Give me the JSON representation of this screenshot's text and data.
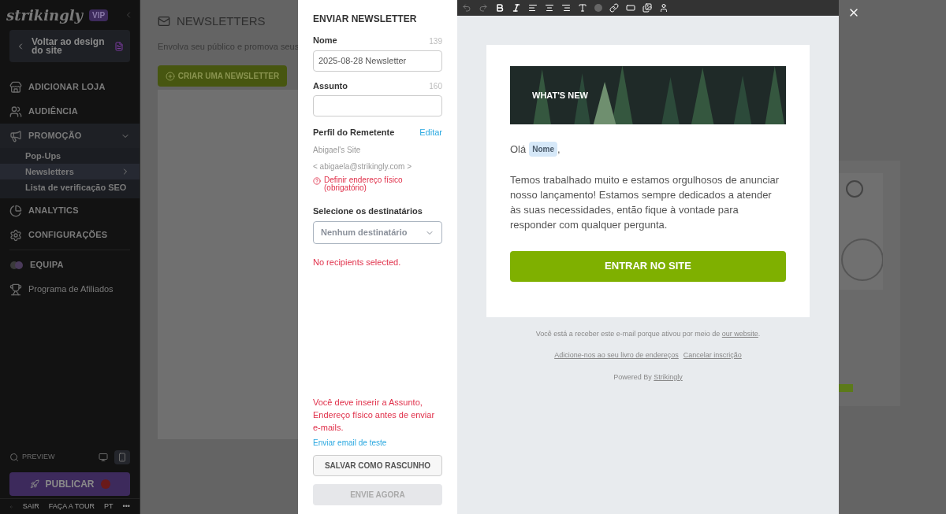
{
  "sidebar": {
    "logo": "strikingly",
    "badge": "VIP",
    "back_button": "Voltar ao design do site",
    "items": [
      {
        "label": "ADICIONAR LOJA",
        "kind": "section"
      },
      {
        "label": "AUDIÊNCIA",
        "kind": "section"
      },
      {
        "label": "PROMOÇÃO",
        "kind": "section",
        "expanded": true,
        "children": [
          {
            "label": "Pop-Ups",
            "selected": false
          },
          {
            "label": "Newsletters",
            "selected": true
          },
          {
            "label": "Lista de verificação SEO",
            "selected": false
          }
        ]
      },
      {
        "label": "ANALYTICS",
        "kind": "section"
      },
      {
        "label": "CONFIGURAÇÕES",
        "kind": "section"
      },
      {
        "label": "EQUIPA",
        "kind": "section"
      },
      {
        "label": "Programa de Afiliados",
        "kind": "plain"
      }
    ],
    "preview": "PREVIEW",
    "devices": [
      {
        "kind": "desktop",
        "selected": false
      },
      {
        "kind": "mobile",
        "selected": true
      }
    ],
    "publish_button": "PUBLICAR",
    "footer": [
      "SAIR",
      "FAÇA A TOUR",
      "PT",
      "•••"
    ]
  },
  "main": {
    "title": "NEWSLETTERS",
    "subtitle": "Envolva seu público e promova seus",
    "create_button": "CRIAR UMA NEWSLETTER"
  },
  "form": {
    "title": "ENVIAR NEWSLETTER",
    "fields": [
      {
        "label": "Nome",
        "counter": "139",
        "value": "2025-08-28 Newsletter"
      },
      {
        "label": "Assunto",
        "counter": "160"
      }
    ],
    "sender": {
      "label": "Perfil do Remetente",
      "edit_link": "Editar",
      "name": "Abigael's Site",
      "email": "< abigaela@strikingly.com >",
      "warning": "Definir endereço físico (obrigatório)"
    },
    "recipients": {
      "label": "Selecione os destinatários",
      "select": "Nenhum destinatário",
      "error": "No recipients selected."
    },
    "validation": "Você deve inserir a Assunto, Endereço físico antes de enviar e-mails.",
    "test_link": "Enviar email de teste",
    "save_button": "SALVAR COMO RASCUNHO",
    "send_button": {
      "label": "ENVIE AGORA",
      "disabled": true
    }
  },
  "email": {
    "banner": "WHAT'S NEW",
    "greeting": "Olá",
    "merge_tag": "Nome",
    "greeting_end": ",",
    "body": "Temos trabalhado muito e estamos orgulhosos de anunciar nosso lançamento! Estamos sempre dedicados a atender às suas necessidades, então fique à vontade para responder com qualquer pergunta.",
    "cta": "ENTRAR NO SITE",
    "notice": "Você está a receber este e-mail porque ativou por meio de",
    "notice_link": "our website",
    "notice_end": ".",
    "links": [
      "Adicione-nos ao seu livro de endereços",
      "Cancelar inscrição"
    ],
    "powered": "Powered By",
    "powered_link": "Strikingly"
  }
}
